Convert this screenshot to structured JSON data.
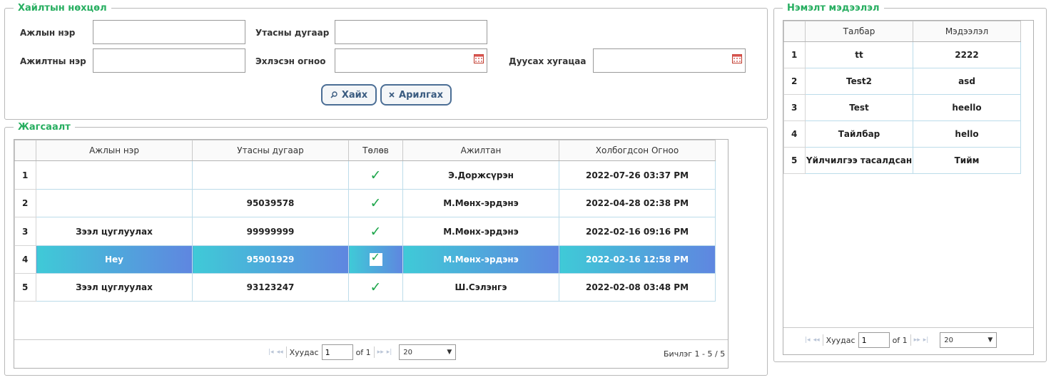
{
  "search": {
    "legend": "Хайлтын нөхцөл",
    "job_name_label": "Ажлын нэр",
    "job_name_value": "",
    "phone_label": "Утасны дугаар",
    "phone_value": "",
    "employee_label": "Ажилтны нэр",
    "employee_value": "",
    "start_date_label": "Эхлэсэн огноо",
    "start_date_value": "",
    "end_date_label": "Дуусах хугацаа",
    "end_date_value": "",
    "search_button": "Хайх",
    "clear_button": "Арилгах",
    "search_icon": "search-icon",
    "clear_icon": "close-icon",
    "calendar_icon": "calendar-icon"
  },
  "list": {
    "legend": "Жагсаалт",
    "columns": [
      "Ажлын нэр",
      "Утасны дугаар",
      "Төлөв",
      "Ажилтан",
      "Холбогдсон Огноо"
    ],
    "rows": [
      {
        "n": "1",
        "job": "",
        "phone": "",
        "employee": "Э.Доржсүрэн",
        "date": "2022-07-26 03:37 PM",
        "status": "done"
      },
      {
        "n": "2",
        "job": "",
        "phone": "95039578",
        "employee": "М.Мөнх-эрдэнэ",
        "date": "2022-04-28 02:38 PM",
        "status": "done"
      },
      {
        "n": "3",
        "job": "Зээл цуглуулах",
        "phone": "99999999",
        "employee": "М.Мөнх-эрдэнэ",
        "date": "2022-02-16 09:16 PM",
        "status": "done"
      },
      {
        "n": "4",
        "job": "Hey",
        "phone": "95901929",
        "employee": "М.Мөнх-эрдэнэ",
        "date": "2022-02-16 12:58 PM",
        "status": "done",
        "selected": true
      },
      {
        "n": "5",
        "job": "Зээл цуглуулах",
        "phone": "93123247",
        "employee": "Ш.Сэлэнгэ",
        "date": "2022-02-08 03:48 PM",
        "status": "done"
      }
    ],
    "pager": {
      "page_label": "Хуудас",
      "page": "1",
      "of": "of 1",
      "page_size": "20",
      "records": "Бичлэг 1 - 5 / 5"
    }
  },
  "extra": {
    "legend": "Нэмэлт мэдээлэл",
    "columns": [
      "Талбар",
      "Мэдээлэл"
    ],
    "rows": [
      {
        "n": "1",
        "field": "tt",
        "info": "2222"
      },
      {
        "n": "2",
        "field": "Test2",
        "info": "asd"
      },
      {
        "n": "3",
        "field": "Test",
        "info": "heello"
      },
      {
        "n": "4",
        "field": "Тайлбар",
        "info": "hello"
      },
      {
        "n": "5",
        "field": "Үйлчилгээ тасалдсан",
        "info": "Тийм"
      }
    ],
    "pager": {
      "page_label": "Хуудас",
      "page": "1",
      "of": "of 1",
      "page_size": "20"
    }
  },
  "colors": {
    "accent": "#27ae60",
    "button": "#4b6e95",
    "check": "#1ea64b",
    "selected_from": "#3fcad7",
    "selected_to": "#5f86e0"
  }
}
